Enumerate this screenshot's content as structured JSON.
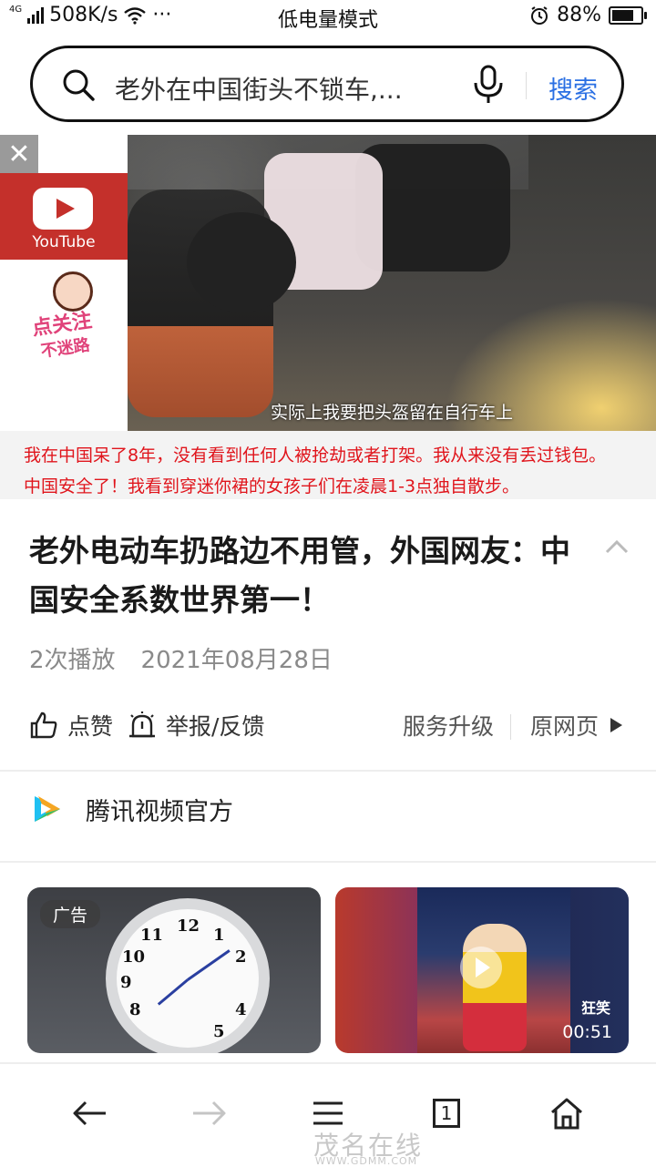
{
  "status_bar": {
    "network_type": "4G",
    "speed": "508K/s",
    "more": "···",
    "mode": "低电量模式",
    "battery_percent": "88%",
    "battery_level": 0.88
  },
  "search": {
    "query": "老外在中国街头不锁车,...",
    "button": "搜索"
  },
  "video": {
    "close": "✕",
    "youtube_label": "YouTube",
    "sticker_line1": "点关注",
    "sticker_line2": "不迷路",
    "subtitle": "实际上我要把头盔留在自行车上",
    "comment_line1": "我在中国呆了8年，没有看到任何人被抢劫或者打架。我从来没有丢过钱包。",
    "comment_line2": "中国安全了！我看到穿迷你裙的女孩子们在凌晨1-3点独自散步。"
  },
  "article": {
    "title": "老外电动车扔路边不用管，外国网友：中国安全系数世界第一！",
    "plays": "2次播放",
    "date": "2021年08月28日"
  },
  "actions": {
    "like": "点赞",
    "report": "举报/反馈",
    "upgrade": "服务升级",
    "original": "原网页"
  },
  "channel": {
    "name": "腾讯视频官方"
  },
  "cards": {
    "ad_badge": "广告",
    "video_duration": "00:51",
    "video_watermark": "狂笑"
  },
  "bottom_nav": {
    "tab_count": "1"
  },
  "watermark": {
    "site": "茂名在线",
    "url": "WWW.GDMM.COM"
  }
}
